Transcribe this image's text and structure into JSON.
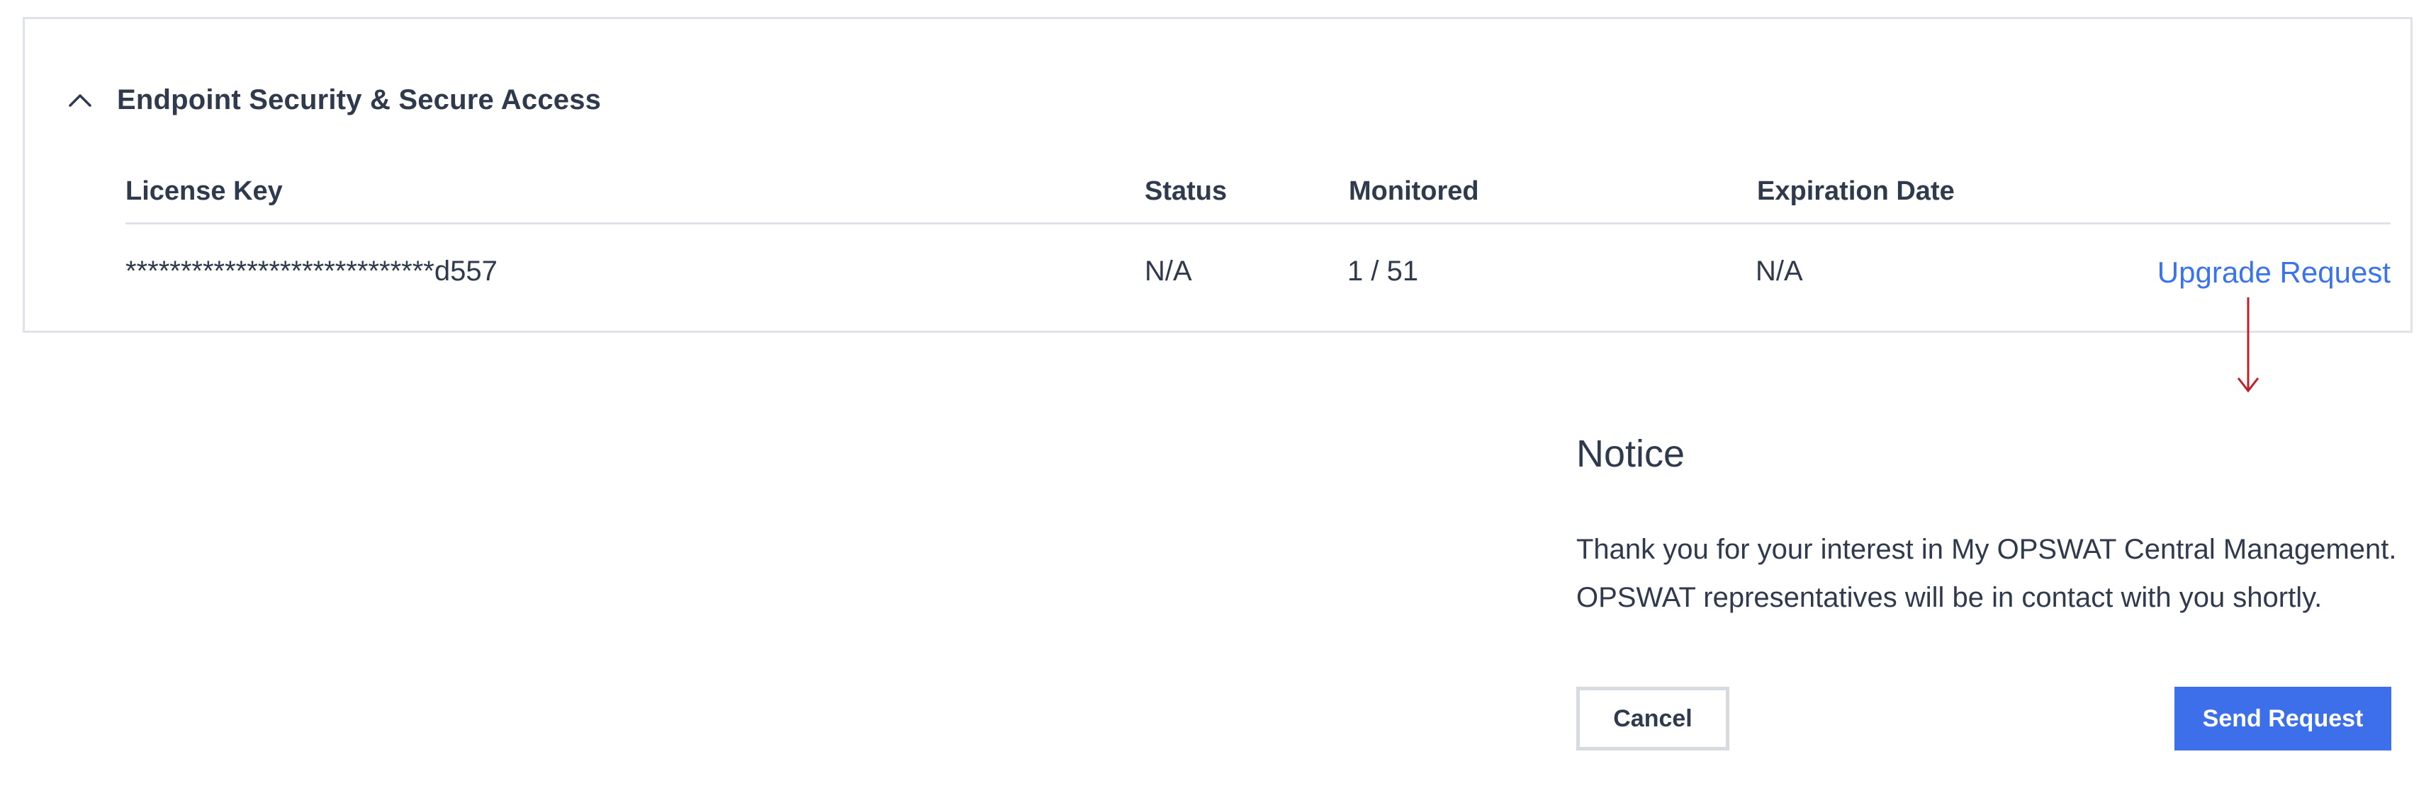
{
  "product_section": {
    "title": "Endpoint Security & Secure Access",
    "toggle_icon": "chevron-up-icon",
    "columns": {
      "license_key": "License Key",
      "status": "Status",
      "monitored": "Monitored",
      "expiration_date": "Expiration Date"
    },
    "rows": [
      {
        "license_key": "****************************d557",
        "status": "N/A",
        "monitored": "1 / 51",
        "expiration_date": "N/A",
        "action_label": "Upgrade Request"
      }
    ]
  },
  "annotation": {
    "icon": "arrow-down-icon",
    "color": "#c0202a"
  },
  "notice_dialog": {
    "title": "Notice",
    "message_lines": [
      "Thank you for your interest in My OPSWAT Central Management.",
      "OPSWAT representatives will be in contact with you shortly."
    ],
    "cancel_label": "Cancel",
    "send_label": "Send Request"
  },
  "colors": {
    "text": "#2f3a4c",
    "link": "#3b73ec",
    "primary_button": "#3d6fea",
    "border": "#dfe2e7"
  }
}
